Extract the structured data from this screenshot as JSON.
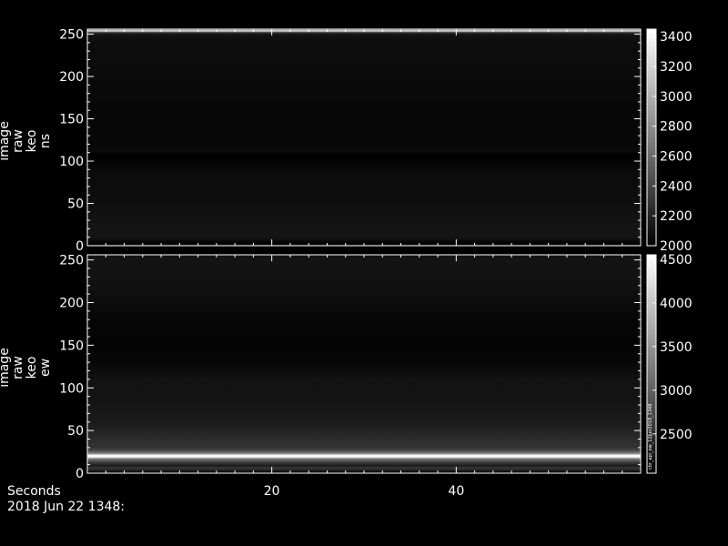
{
  "chart_data": [
    {
      "type": "heatmap",
      "ylabel": [
        "image",
        "raw",
        "keo",
        "ns"
      ],
      "yticks": [
        0,
        50,
        100,
        150,
        200,
        250
      ],
      "ylim": [
        0,
        256
      ],
      "xlim": [
        0,
        60
      ],
      "colorbar": {
        "range": [
          2000,
          3450
        ],
        "ticks": [
          2000,
          2200,
          2400,
          2600,
          2800,
          3000,
          3200,
          3400
        ]
      },
      "profile": [
        [
          0,
          2250
        ],
        [
          2,
          2000
        ],
        [
          10,
          2120
        ],
        [
          30,
          2110
        ],
        [
          50,
          2080
        ],
        [
          90,
          2060
        ],
        [
          100,
          2020
        ],
        [
          104,
          1990
        ],
        [
          108,
          2000
        ],
        [
          112,
          2060
        ],
        [
          120,
          2040
        ],
        [
          150,
          2040
        ],
        [
          200,
          2060
        ],
        [
          240,
          2070
        ],
        [
          250,
          2110
        ],
        [
          252,
          2350
        ],
        [
          254,
          3400
        ],
        [
          256,
          2000
        ]
      ]
    },
    {
      "type": "heatmap",
      "ylabel": [
        "image",
        "raw",
        "keo",
        "ew"
      ],
      "yticks": [
        0,
        50,
        100,
        150,
        200,
        250
      ],
      "ylim": [
        0,
        256
      ],
      "xlim": [
        0,
        60
      ],
      "colorbar": {
        "range": [
          2050,
          4550
        ],
        "ticks": [
          2500,
          3000,
          3500,
          4000,
          4500
        ]
      },
      "colorbar_note": "cbr_api_ew_12Jun2018_1348",
      "profile": [
        [
          0,
          2050
        ],
        [
          6,
          2600
        ],
        [
          9,
          2300
        ],
        [
          14,
          2800
        ],
        [
          17,
          3300
        ],
        [
          19,
          4500
        ],
        [
          21,
          4500
        ],
        [
          23,
          3400
        ],
        [
          26,
          2800
        ],
        [
          30,
          2560
        ],
        [
          40,
          2480
        ],
        [
          60,
          2300
        ],
        [
          90,
          2240
        ],
        [
          110,
          2230
        ],
        [
          130,
          2120
        ],
        [
          150,
          2090
        ],
        [
          180,
          2110
        ],
        [
          210,
          2200
        ],
        [
          230,
          2230
        ],
        [
          256,
          2250
        ]
      ]
    }
  ],
  "xaxis": {
    "title": "Seconds",
    "ticks": [
      20,
      40
    ]
  },
  "timestamp": "2018 Jun 22 1348:"
}
